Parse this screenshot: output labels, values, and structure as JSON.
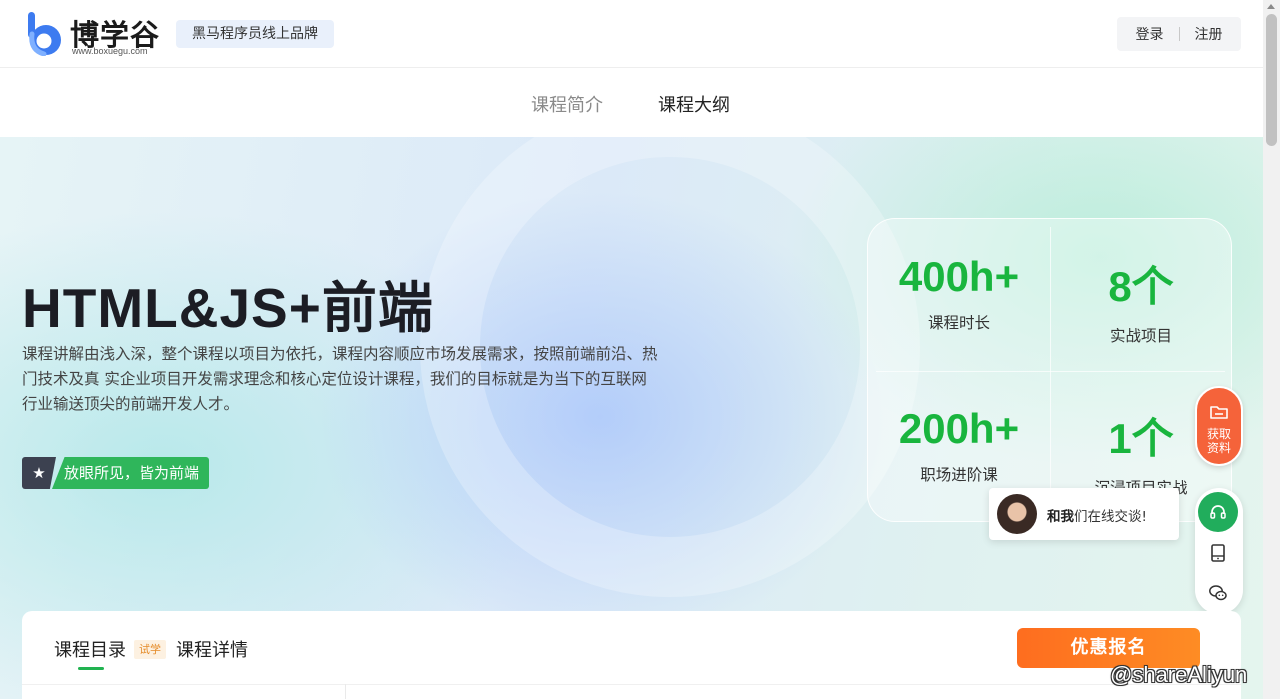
{
  "header": {
    "logo_text": "博学谷",
    "logo_url": "www.boxuegu.com",
    "brand_tag": "黑马程序员线上品牌",
    "login": "登录",
    "register": "注册"
  },
  "subnav": {
    "tabs": [
      {
        "label": "课程简介",
        "active": false
      },
      {
        "label": "课程大纲",
        "active": true
      }
    ]
  },
  "hero": {
    "title": "HTML&JS+前端",
    "description": "课程讲解由浅入深，整个课程以项目为依托，课程内容顺应市场发展需求，按照前端前沿、热门技术及真 实企业项目开发需求理念和核心定位设计课程，我们的目标就是为当下的互联网行业输送顶尖的前端开发人才。",
    "slogan_icon": "star-icon",
    "slogan": "放眼所见，皆为前端"
  },
  "stats": [
    {
      "value": "400h+",
      "label": "课程时长"
    },
    {
      "value": "8个",
      "label": "实战项目"
    },
    {
      "value": "200h+",
      "label": "职场进阶课"
    },
    {
      "value": "1个",
      "label": "沉浸项目实战"
    }
  ],
  "floating": {
    "get_materials": "获取资料",
    "get_materials_line1": "获取",
    "get_materials_line2": "资料",
    "chat_bold": "和我",
    "chat_rest": "们在线交谈!",
    "icons": [
      "folder-icon",
      "headset-icon",
      "tablet-icon",
      "wechat-icon"
    ]
  },
  "panel": {
    "tab_catalog": "课程目录",
    "trial_badge": "试学",
    "tab_details": "课程详情",
    "enroll_button": "优惠报名"
  },
  "watermark": "@shareAliyun",
  "colors": {
    "accent_green": "#19b53e",
    "enroll_orange": "#fe7a22",
    "float_orange": "#f5633a",
    "headset_green": "#21ad5c"
  }
}
